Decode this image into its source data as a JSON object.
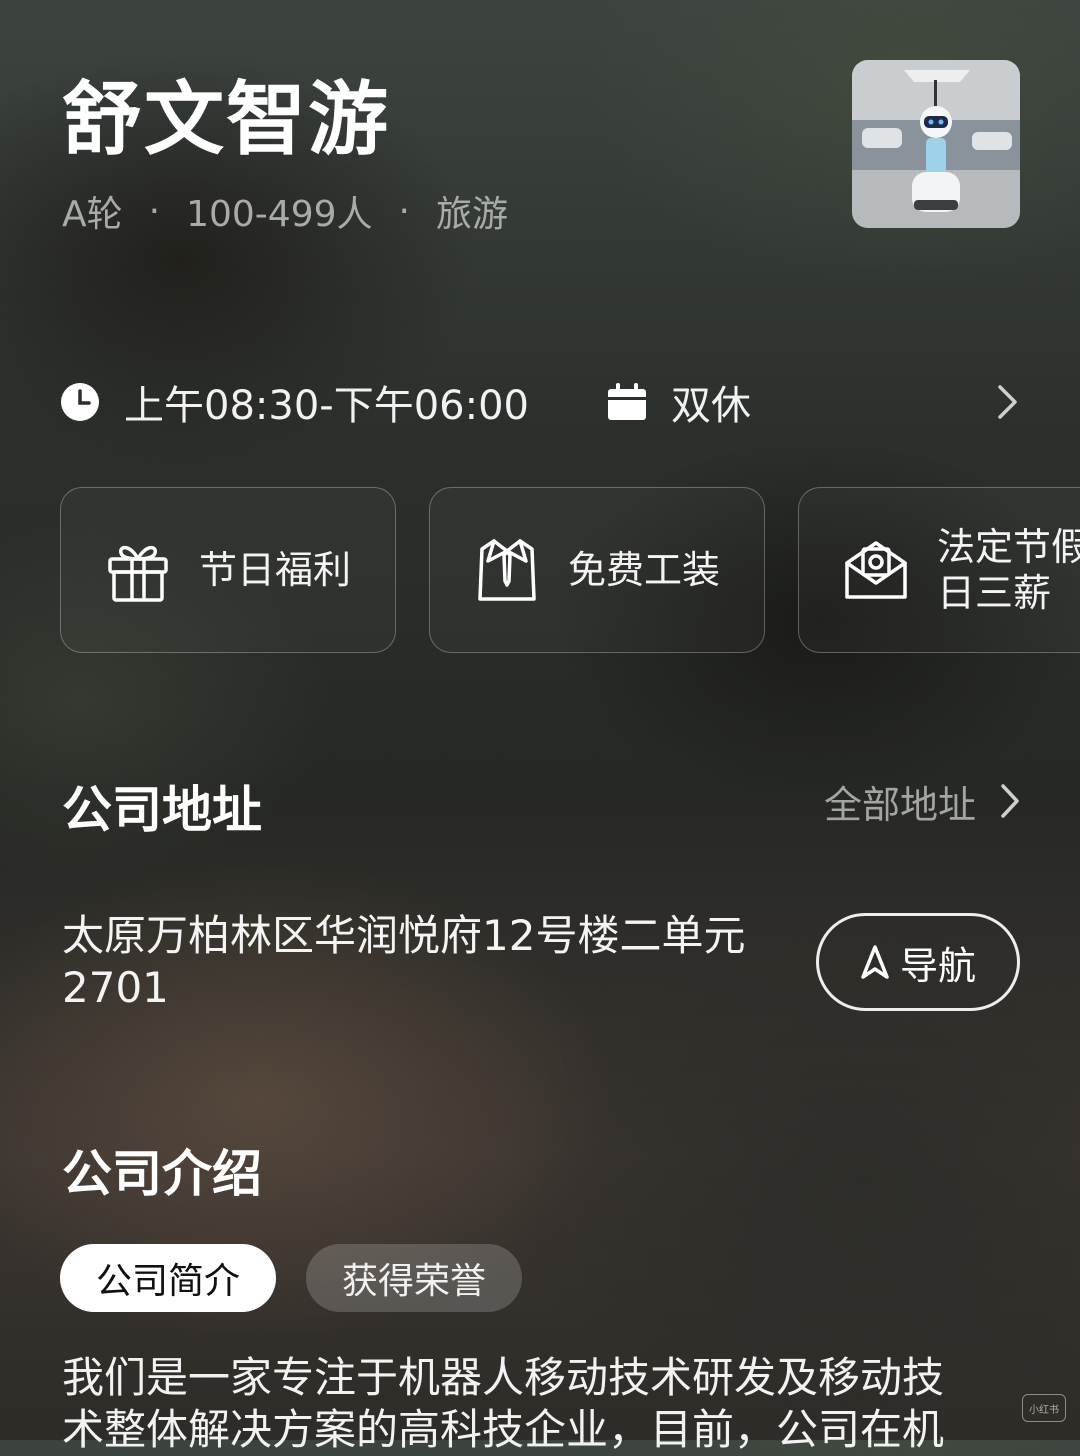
{
  "company": {
    "name": "舒文智游",
    "funding": "A轮",
    "size": "100-499人",
    "industry": "旅游",
    "separator": "·"
  },
  "schedule": {
    "hours": "上午08:30-下午06:00",
    "rest": "双休"
  },
  "benefits": [
    {
      "label": "节日福利",
      "icon": "gift-icon"
    },
    {
      "label": "免费工装",
      "icon": "uniform-icon"
    },
    {
      "label": "法定节假\n日三薪",
      "icon": "envelope-icon"
    }
  ],
  "address": {
    "title": "公司地址",
    "all_link": "全部地址",
    "text": "太原万柏林区华润悦府12号楼二单元2701",
    "nav_label": "导航"
  },
  "intro": {
    "title": "公司介绍",
    "tabs": [
      "公司简介",
      "获得荣誉"
    ],
    "text": "我们是一家专注于机器人移动技术研发及移动技\n术整体解决方案的高科技企业，目前，公司在机"
  },
  "watermark": "小红书",
  "colors": {
    "text_primary": "#ffffff",
    "text_secondary": "#a9aba7",
    "pill_active_bg": "#ffffff"
  }
}
